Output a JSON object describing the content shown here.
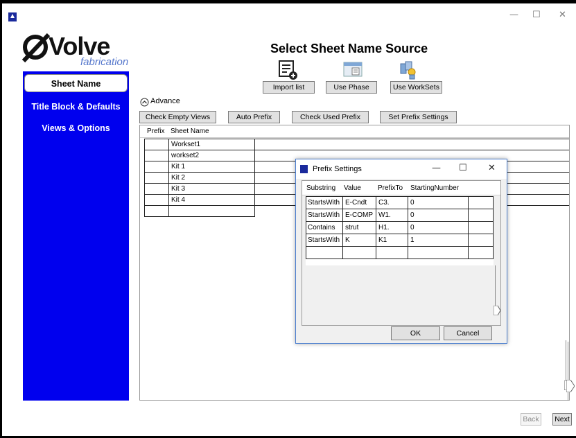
{
  "window": {
    "minimize": "—",
    "maximize": "☐",
    "close": "✕"
  },
  "logo": {
    "brand": "Volve",
    "sub": "fabrication"
  },
  "sidebar": {
    "items": [
      {
        "label": "Sheet Name",
        "active": true
      },
      {
        "label": "Title Block & Defaults",
        "active": false
      },
      {
        "label": "Views & Options",
        "active": false
      }
    ]
  },
  "header": {
    "title": "Select Sheet Name Source"
  },
  "source_buttons": {
    "import": "Import list",
    "phase": "Use Phase",
    "worksets": "Use WorkSets"
  },
  "advance": {
    "label": "Advance"
  },
  "toolbar": {
    "check_empty": "Check Empty Views",
    "auto_prefix": "Auto Prefix",
    "check_used": "Check Used Prefix",
    "set_prefix": "Set Prefix Settings"
  },
  "table": {
    "columns": [
      "Prefix",
      "Sheet Name"
    ],
    "rows": [
      {
        "prefix": "",
        "sheet": "Workset1"
      },
      {
        "prefix": "",
        "sheet": "workset2"
      },
      {
        "prefix": "",
        "sheet": "Kit 1"
      },
      {
        "prefix": "",
        "sheet": "Kit 2"
      },
      {
        "prefix": "",
        "sheet": "Kit 3"
      },
      {
        "prefix": "",
        "sheet": "Kit 4"
      },
      {
        "prefix": "",
        "sheet": ""
      }
    ]
  },
  "dialog": {
    "title": "Prefix Settings",
    "columns": [
      "Substring",
      "Value",
      "PrefixTo",
      "StartingNumber"
    ],
    "rows": [
      [
        "StartsWith",
        "E-Cndt",
        "C3.",
        "0"
      ],
      [
        "StartsWith",
        "E-COMP",
        "W1.",
        "0"
      ],
      [
        "Contains",
        "strut",
        "H1.",
        "0"
      ],
      [
        "StartsWith",
        "K",
        "K1",
        "1"
      ],
      [
        "",
        "",
        "",
        ""
      ]
    ],
    "ok": "OK",
    "cancel": "Cancel"
  },
  "footer": {
    "back": "Back",
    "next": "Next"
  },
  "colors": {
    "sidebar": "#0000ee",
    "dialog_border": "#4a7ed0"
  }
}
